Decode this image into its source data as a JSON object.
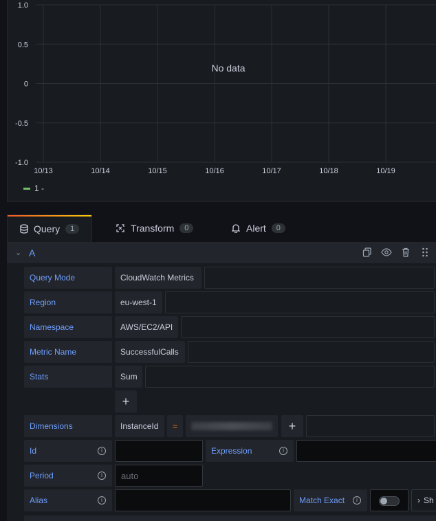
{
  "chart_data": {
    "type": "line",
    "title": "",
    "x": [
      "10/13",
      "10/14",
      "10/15",
      "10/16",
      "10/17",
      "10/18",
      "10/19"
    ],
    "yticks": [
      "1.0",
      "0.5",
      "0",
      "-0.5",
      "-1.0"
    ],
    "ylim": [
      -1.0,
      1.0
    ],
    "series": [
      {
        "name": "1 -",
        "values": [],
        "color": "#73bf69"
      }
    ],
    "message": "No data",
    "grid": true,
    "legend": "bottom-left"
  },
  "tabs": [
    {
      "label": "Query",
      "count": "1",
      "icon": "database-icon"
    },
    {
      "label": "Transform",
      "count": "0",
      "icon": "transform-icon"
    },
    {
      "label": "Alert",
      "count": "0",
      "icon": "bell-icon"
    }
  ],
  "query": {
    "name": "A",
    "rows": {
      "query_mode": {
        "label": "Query Mode",
        "value": "CloudWatch Metrics"
      },
      "region": {
        "label": "Region",
        "value": "eu-west-1"
      },
      "namespace": {
        "label": "Namespace",
        "value": "AWS/EC2/API"
      },
      "metric_name": {
        "label": "Metric Name",
        "value": "SuccessfulCalls"
      },
      "stats": {
        "label": "Stats",
        "value": "Sum"
      },
      "dimensions": {
        "label": "Dimensions",
        "key": "InstanceId",
        "operator": "="
      },
      "id": {
        "label": "Id",
        "value": ""
      },
      "expression": {
        "label": "Expression",
        "value": ""
      },
      "period": {
        "label": "Period",
        "placeholder": "auto"
      },
      "alias": {
        "label": "Alias",
        "value": ""
      },
      "match_exact": {
        "label": "Match Exact",
        "enabled": false
      },
      "show_more": {
        "label": "Sh"
      }
    }
  },
  "colors": {
    "accent": "#6e9fff",
    "legend": "#73bf69",
    "operator": "#ff780a"
  }
}
